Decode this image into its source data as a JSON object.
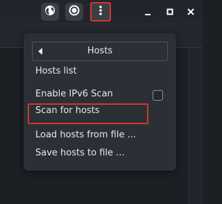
{
  "titlebar": {
    "buttons": [
      {
        "icon": "globe-icon"
      },
      {
        "icon": "record-icon"
      },
      {
        "icon": "kebab-menu-icon"
      }
    ],
    "window_controls": [
      "minimize-icon",
      "maximize-icon",
      "close-icon"
    ]
  },
  "menu": {
    "header": "Hosts",
    "items": [
      {
        "label": "Hosts list"
      },
      {
        "label": "Enable IPv6 Scan",
        "checked": false
      },
      {
        "label": "Scan for hosts"
      },
      {
        "label": "Load hosts from file ..."
      },
      {
        "label": "Save hosts to file ..."
      }
    ]
  },
  "colors": {
    "background": "#1c1f24",
    "menu_background": "#2b2f36",
    "annotation_red": "#d9362b",
    "text": "#e8eaed"
  }
}
